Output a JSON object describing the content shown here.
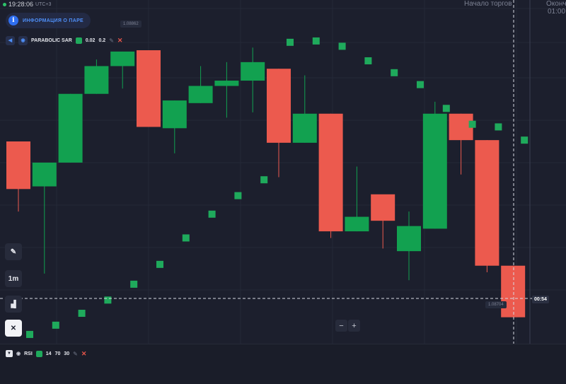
{
  "status_bar": {
    "time": "19:28:06",
    "timezone": "UTC+3"
  },
  "pair_info_button": {
    "label": "ИНФОРМАЦИЯ О ПАРЕ",
    "icon": "info-icon"
  },
  "indicator_sar": {
    "name": "PARABOLIC SAR",
    "param1": "0.02",
    "param2": "0.2",
    "color": "#1faa5c"
  },
  "session": {
    "start_label": "Начало торгов",
    "end_label": "Оконч",
    "end_time": "01:00"
  },
  "price_labels": {
    "top": "1.08862",
    "current": "1.08704"
  },
  "timer": "00:54",
  "toolbar": {
    "pencil": "pencil-icon",
    "timeframe": "1m",
    "chart_type": "chart-type-icon",
    "tools": "tools-icon"
  },
  "zoom": {
    "minus": "−",
    "plus": "+"
  },
  "indicator_rsi": {
    "name": "RSI",
    "p1": "14",
    "p2": "70",
    "p3": "30"
  },
  "colors": {
    "bull": "#12a150",
    "bear": "#ec5a4e",
    "background": "#1c1f2d",
    "sar": "#1faa5c",
    "rsi_line": "#1fa85a"
  },
  "chart_data": {
    "type": "candlestick",
    "price_range": [
      1.0863,
      1.0889
    ],
    "candles": [
      {
        "o": 1.08747,
        "h": 1.08781,
        "l": 1.0873,
        "c": 1.08783,
        "dir": "down"
      },
      {
        "o": 1.08749,
        "h": 1.08762,
        "l": 1.08683,
        "c": 1.08767,
        "dir": "up"
      },
      {
        "o": 1.08767,
        "h": 1.08819,
        "l": 1.08767,
        "c": 1.08819,
        "dir": "up"
      },
      {
        "o": 1.08819,
        "h": 1.08845,
        "l": 1.08819,
        "c": 1.0884,
        "dir": "up"
      },
      {
        "o": 1.0884,
        "h": 1.08851,
        "l": 1.08823,
        "c": 1.08851,
        "dir": "up"
      },
      {
        "o": 1.08852,
        "h": 1.08852,
        "l": 1.08794,
        "c": 1.08794,
        "dir": "down"
      },
      {
        "o": 1.08793,
        "h": 1.08814,
        "l": 1.08774,
        "c": 1.08814,
        "dir": "up"
      },
      {
        "o": 1.08812,
        "h": 1.0884,
        "l": 1.08812,
        "c": 1.08825,
        "dir": "up"
      },
      {
        "o": 1.08825,
        "h": 1.08843,
        "l": 1.08801,
        "c": 1.08829,
        "dir": "up"
      },
      {
        "o": 1.08829,
        "h": 1.08854,
        "l": 1.08805,
        "c": 1.08843,
        "dir": "up"
      },
      {
        "o": 1.08838,
        "h": 1.08838,
        "l": 1.08756,
        "c": 1.08782,
        "dir": "down"
      },
      {
        "o": 1.08782,
        "h": 1.08833,
        "l": 1.08782,
        "c": 1.08804,
        "dir": "up"
      },
      {
        "o": 1.08804,
        "h": 1.08804,
        "l": 1.0871,
        "c": 1.08715,
        "dir": "down"
      },
      {
        "o": 1.08715,
        "h": 1.08764,
        "l": 1.08715,
        "c": 1.08726,
        "dir": "up"
      },
      {
        "o": 1.08723,
        "h": 1.08728,
        "l": 1.08702,
        "c": 1.08743,
        "dir": "down"
      },
      {
        "o": 1.087,
        "h": 1.0873,
        "l": 1.08678,
        "c": 1.08719,
        "dir": "up"
      },
      {
        "o": 1.08717,
        "h": 1.08813,
        "l": 1.08717,
        "c": 1.08804,
        "dir": "up"
      },
      {
        "o": 1.08804,
        "h": 1.08804,
        "l": 1.08758,
        "c": 1.08784,
        "dir": "down"
      },
      {
        "o": 1.08784,
        "h": 1.08784,
        "l": 1.08684,
        "c": 1.08689,
        "dir": "down"
      },
      {
        "o": 1.08689,
        "h": 1.08689,
        "l": 1.0865,
        "c": 1.0865,
        "dir": "down"
      }
    ],
    "sar": [
      1.08637,
      1.08644,
      1.08653,
      1.08663,
      1.08675,
      1.0869,
      1.0871,
      1.08728,
      1.08742,
      1.08754,
      1.08858,
      1.08859,
      1.08855,
      1.08844,
      1.08835,
      1.08826,
      1.08808,
      1.08796,
      1.08794,
      1.08784
    ]
  }
}
